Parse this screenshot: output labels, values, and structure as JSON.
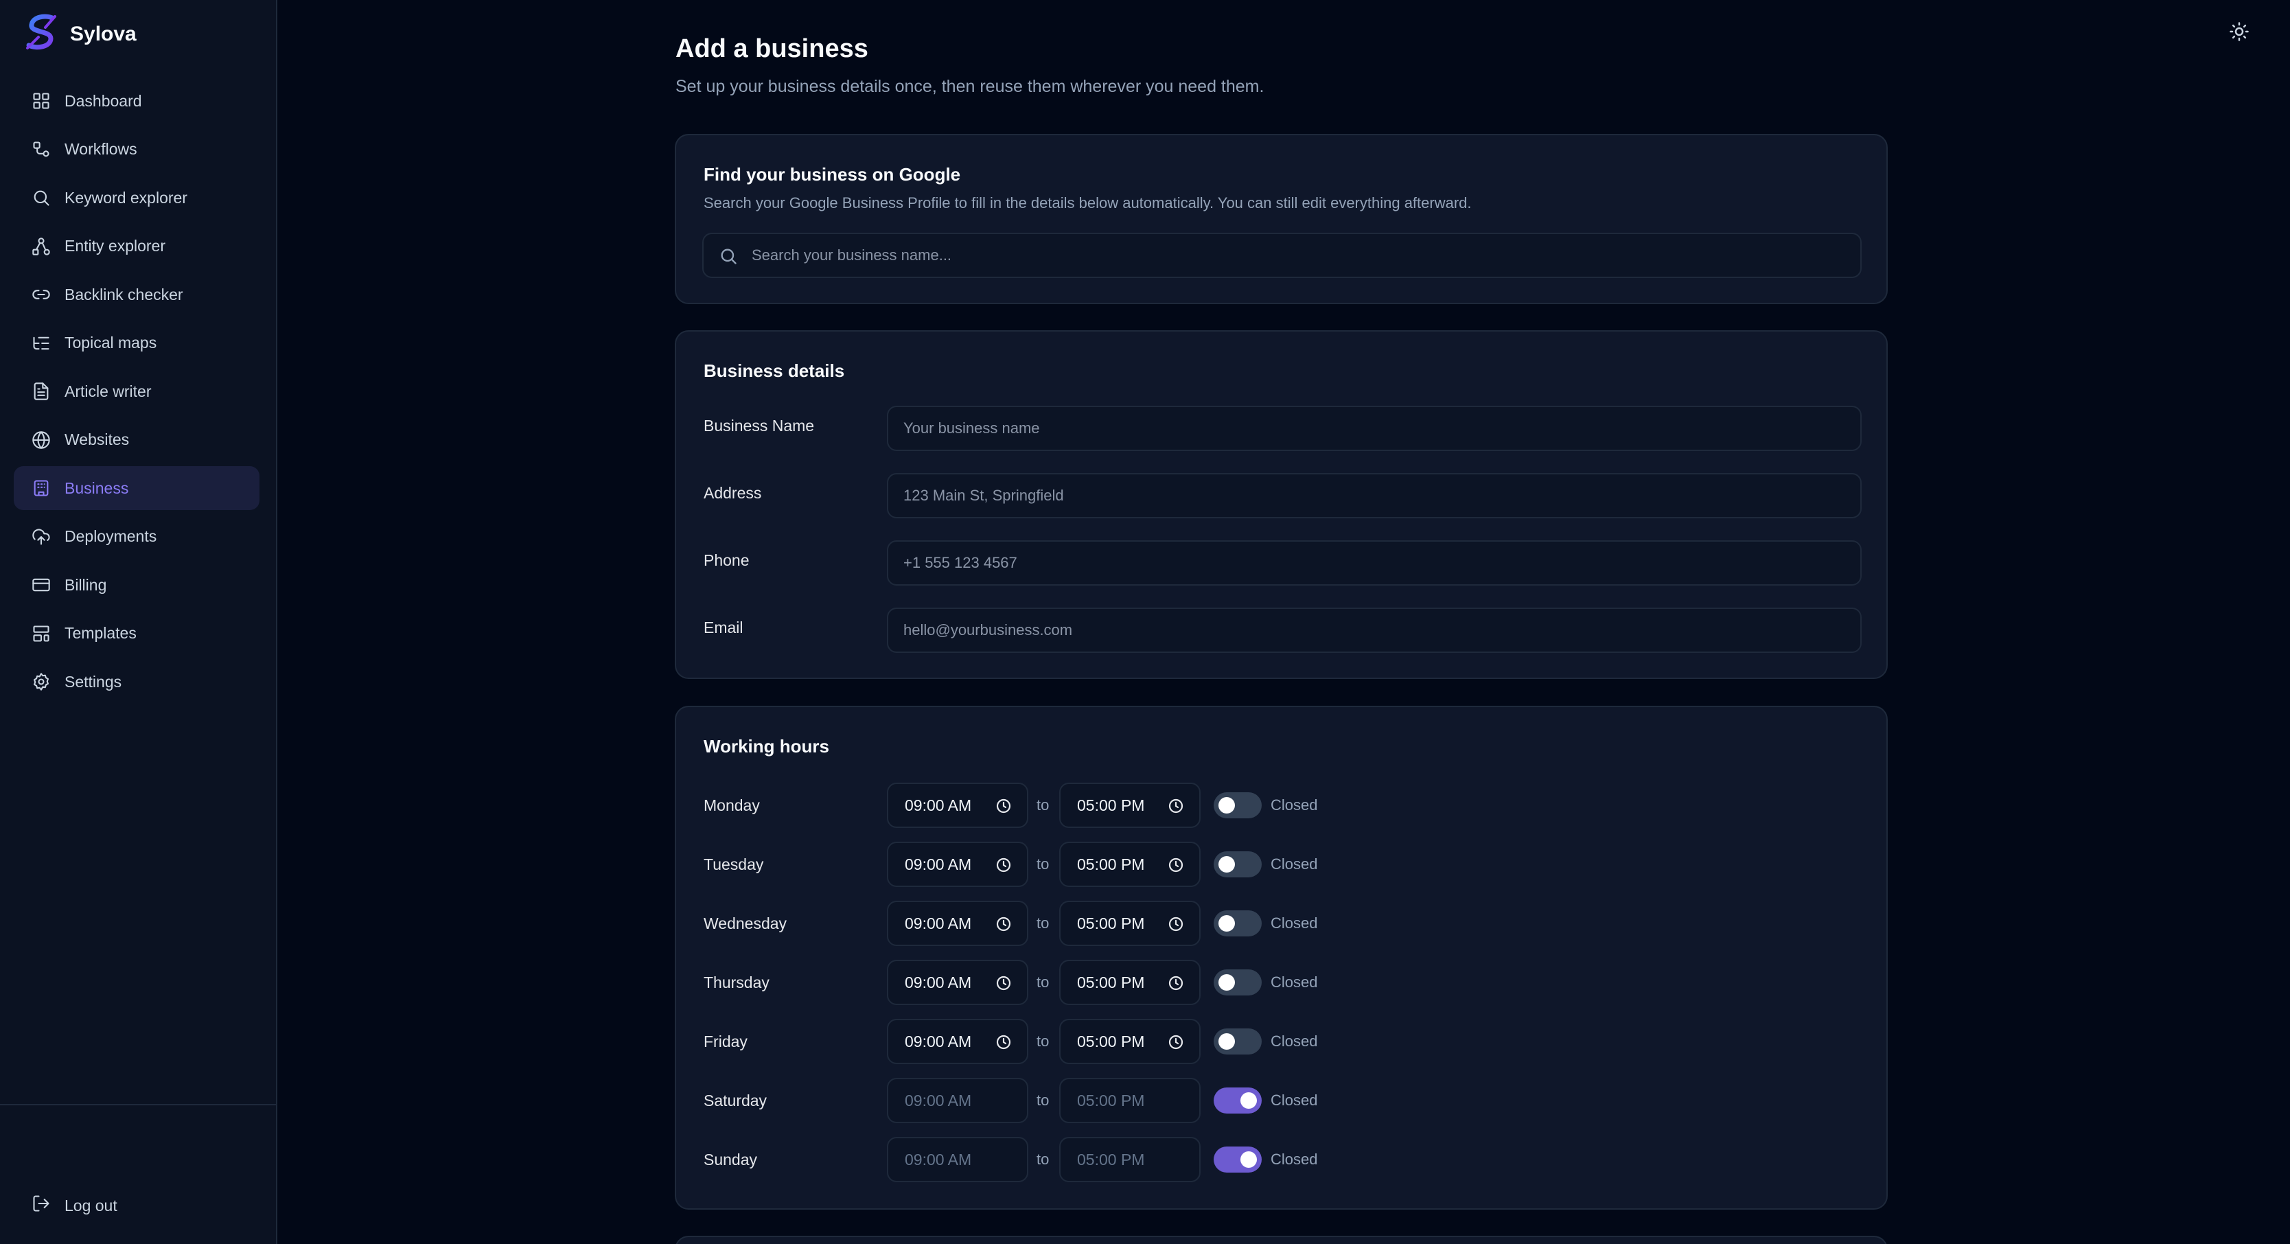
{
  "app": {
    "name": "Sylova",
    "logo_colors": [
      "#7c3aed",
      "#3b82f6"
    ]
  },
  "sidebar": {
    "items": [
      {
        "label": "Dashboard",
        "icon": "dashboard-icon"
      },
      {
        "label": "Workflows",
        "icon": "workflow-icon"
      },
      {
        "label": "Keyword explorer",
        "icon": "search-icon"
      },
      {
        "label": "Entity explorer",
        "icon": "entity-icon"
      },
      {
        "label": "Backlink checker",
        "icon": "link-icon"
      },
      {
        "label": "Topical maps",
        "icon": "list-tree-icon"
      },
      {
        "label": "Article writer",
        "icon": "file-text-icon"
      },
      {
        "label": "Websites",
        "icon": "globe-icon"
      },
      {
        "label": "Business",
        "icon": "building-icon",
        "active": true
      },
      {
        "label": "Deployments",
        "icon": "cloud-upload-icon"
      },
      {
        "label": "Billing",
        "icon": "credit-card-icon"
      },
      {
        "label": "Templates",
        "icon": "layout-template-icon"
      },
      {
        "label": "Settings",
        "icon": "gear-icon"
      }
    ],
    "logout_label": "Log out"
  },
  "page": {
    "title": "Add a business",
    "subtitle": "Set up your business details once, then reuse them wherever you need them."
  },
  "google_card": {
    "title": "Find your business on Google",
    "description": "Search your Google Business Profile to fill in the details below automatically. You can still edit everything afterward.",
    "search_placeholder": "Search your business name..."
  },
  "details_card": {
    "title": "Business details",
    "fields": [
      {
        "label": "Business Name",
        "placeholder": "Your business name"
      },
      {
        "label": "Address",
        "placeholder": "123 Main St, Springfield"
      },
      {
        "label": "Phone",
        "placeholder": "+1 555 123 4567"
      },
      {
        "label": "Email",
        "placeholder": "hello@yourbusiness.com"
      }
    ]
  },
  "hours_card": {
    "title": "Working hours",
    "to_label": "to",
    "closed_label": "Closed",
    "days": [
      {
        "day": "Monday",
        "open": "09:00 AM",
        "close": "05:00 PM",
        "closed": false
      },
      {
        "day": "Tuesday",
        "open": "09:00 AM",
        "close": "05:00 PM",
        "closed": false
      },
      {
        "day": "Wednesday",
        "open": "09:00 AM",
        "close": "05:00 PM",
        "closed": false
      },
      {
        "day": "Thursday",
        "open": "09:00 AM",
        "close": "05:00 PM",
        "closed": false
      },
      {
        "day": "Friday",
        "open": "09:00 AM",
        "close": "05:00 PM",
        "closed": false
      },
      {
        "day": "Saturday",
        "open": "09:00 AM",
        "close": "05:00 PM",
        "closed": true
      },
      {
        "day": "Sunday",
        "open": "09:00 AM",
        "close": "05:00 PM",
        "closed": true
      }
    ]
  },
  "colors": {
    "accent": "#6d5bd0",
    "active_nav_text": "#8b7cf6",
    "background": "#020817",
    "card": "#0f172a"
  }
}
